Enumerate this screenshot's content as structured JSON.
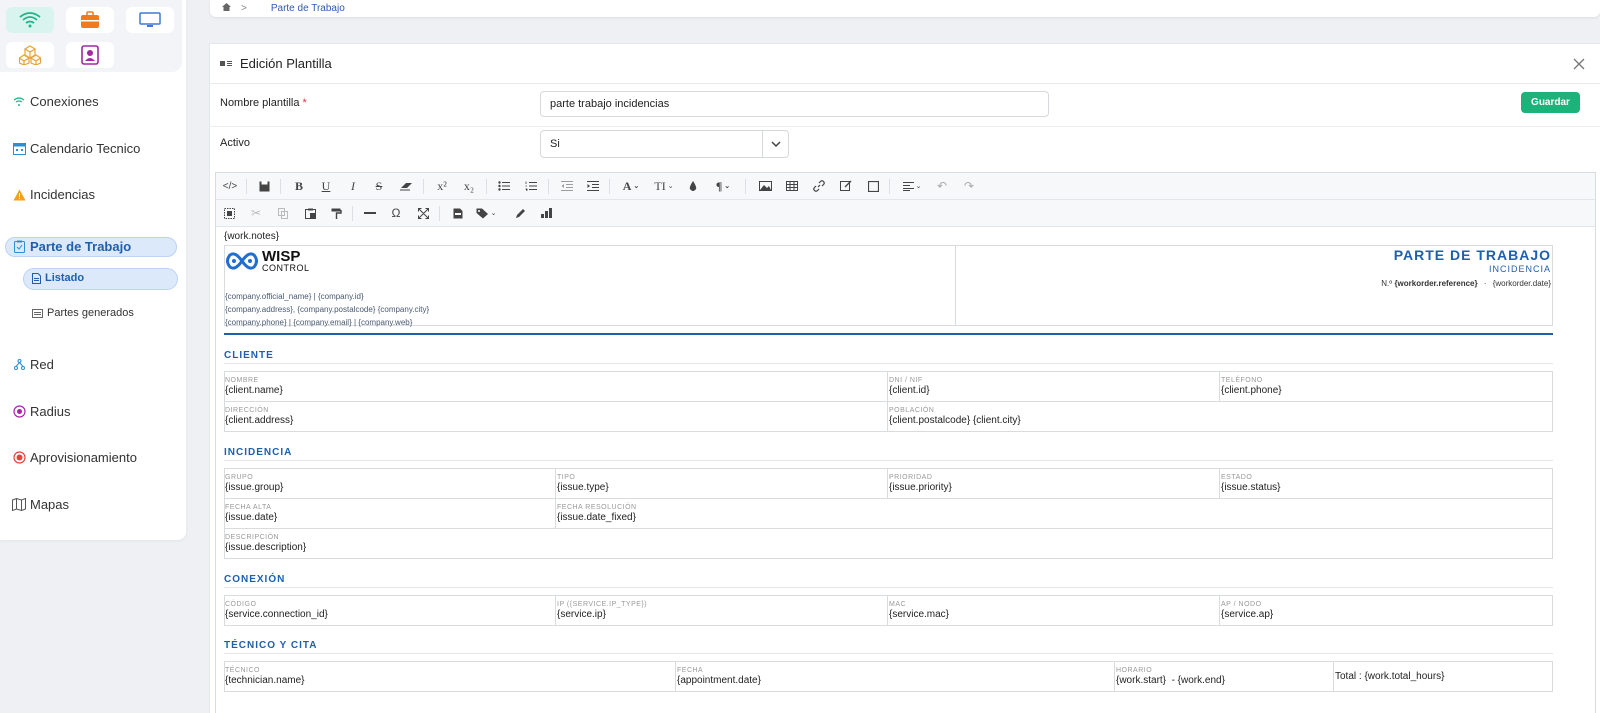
{
  "breadcrumb": {
    "home_icon": "home-icon",
    "separator": ">",
    "current": "Parte de Trabajo"
  },
  "sidebar": {
    "apps": [
      "wifi-icon",
      "briefcase-icon",
      "monitor-icon",
      "cubes-icon",
      "user-badge-icon"
    ],
    "items": [
      {
        "label": "Conexiones",
        "icon": "wifi-small-icon"
      },
      {
        "label": "Calendario Tecnico",
        "icon": "calendar-icon"
      },
      {
        "label": "Incidencias",
        "icon": "warning-icon"
      },
      {
        "label": "Parte de Trabajo",
        "icon": "clipboard-icon"
      },
      {
        "label": "Red",
        "icon": "network-icon"
      },
      {
        "label": "Radius",
        "icon": "radius-icon"
      },
      {
        "label": "Aprovisionamiento",
        "icon": "provisioning-icon"
      },
      {
        "label": "Mapas",
        "icon": "map-icon"
      }
    ],
    "sub": [
      {
        "label": "Listado"
      },
      {
        "label": "Partes generados"
      }
    ]
  },
  "panel": {
    "title": "Edición Plantilla"
  },
  "form": {
    "name_label": "Nombre plantilla",
    "required": "*",
    "name_value": "parte trabajo incidencias",
    "active_label": "Activo",
    "active_value": "Si",
    "save_label": "Guardar"
  },
  "doc": {
    "notes": "{work.notes}",
    "logo_main": "WISP",
    "logo_sub": "CONTROL",
    "company_line1": "{company.official_name}  |  {company.id}",
    "company_line2": "{company.address}, {company.postalcode} {company.city}",
    "company_line3": "{company.phone}  |  {company.email}  |  {company.web}",
    "title": "PARTE DE TRABAJO",
    "subtitle": "INCIDENCIA",
    "ref_prefix": "N.º",
    "ref": "{workorder.reference}",
    "ref_sep": "·",
    "ref_date": "{workorder.date}",
    "cliente": {
      "title": "CLIENTE",
      "nombre_cap": "NOMBRE",
      "nombre": "{client.name}",
      "dni_cap": "DNI / NIF",
      "dni": "{client.id}",
      "tel_cap": "TELÉFONO",
      "tel": "{client.phone}",
      "dir_cap": "DIRECCIÓN",
      "dir": "{client.address}",
      "pob_cap": "POBLACIÓN",
      "pob": "{client.postalcode} {client.city}"
    },
    "incidencia": {
      "title": "INCIDENCIA",
      "grupo_cap": "GRUPO",
      "grupo": "{issue.group}",
      "tipo_cap": "TIPO",
      "tipo": "{issue.type}",
      "prio_cap": "PRIORIDAD",
      "prio": "{issue.priority}",
      "estado_cap": "ESTADO",
      "estado": "{issue.status}",
      "alta_cap": "FECHA ALTA",
      "alta": "{issue.date}",
      "res_cap": "FECHA RESOLUCIÓN",
      "res": "{issue.date_fixed}",
      "desc_cap": "DESCRIPCIÓN",
      "desc": "{issue.description}"
    },
    "conexion": {
      "title": "CONEXIÓN",
      "cod_cap": "CÓDIGO",
      "cod": "{service.connection_id}",
      "ip_cap": "IP ({SERVICE.IP_TYPE})",
      "ip": "{service.ip}",
      "mac_cap": "MAC",
      "mac": "{service.mac}",
      "ap_cap": "AP / NODO",
      "ap": "{service.ap}"
    },
    "tecnico": {
      "title": "TÉCNICO Y CITA",
      "tec_cap": "TÉCNICO",
      "tec": "{technician.name}",
      "fecha_cap": "FECHA",
      "fecha": "{appointment.date}",
      "hor_cap": "HORARIO",
      "hor": "{work.start}  - {work.end}",
      "total": "Total : {work.total_hours}"
    }
  },
  "colors": {
    "accent": "#1e5fae",
    "save": "#1cb37a",
    "active_bg": "#dce9fb"
  }
}
